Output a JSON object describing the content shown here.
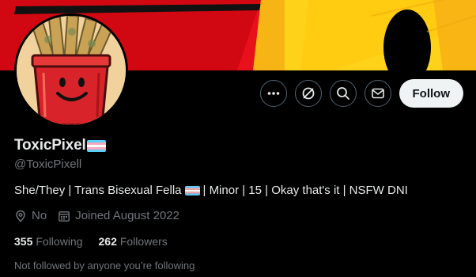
{
  "profile": {
    "display_name": "ToxicPixel",
    "handle": "@ToxicPixell",
    "bio": {
      "before_flag": "She/They | Trans Bisexual Fella",
      "after_flag": "| Minor | 15 | Okay that's it | NSFW DNI"
    },
    "location": "No",
    "joined": "Joined August 2022"
  },
  "stats": {
    "following_count": "355",
    "following_label": "Following",
    "followers_count": "262",
    "followers_label": "Followers"
  },
  "follow_context": "Not followed by anyone you’re following",
  "actions": {
    "follow_label": "Follow",
    "more_icon": "more-icon",
    "grok_icon": "grok-icon",
    "search_icon": "search-icon",
    "message_icon": "message-icon"
  },
  "colors": {
    "follow_bg": "#eff3f4",
    "banner_red": "#e8101a",
    "banner_yellow": "#ffd21a",
    "trans_blue": "#5bcefa",
    "trans_pink": "#f5a9b8"
  }
}
